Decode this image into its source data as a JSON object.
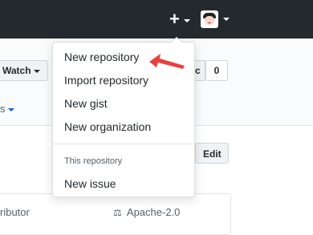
{
  "header": {
    "plus_icon": "+",
    "colors": {
      "background": "#24292e",
      "foreground": "#ffffff"
    }
  },
  "repo_actions": {
    "watch_label": "Watch",
    "star_count": "0",
    "partial_button_text": "c"
  },
  "tabs": {
    "partial_tab_text": "s"
  },
  "edit_button": {
    "label": "Edit"
  },
  "summary": {
    "contributors_text": "ributor",
    "license_icon": "⚖",
    "license_text": "Apache-2.0"
  },
  "dropdown": {
    "items": [
      {
        "label": "New repository"
      },
      {
        "label": "Import repository"
      },
      {
        "label": "New gist"
      },
      {
        "label": "New organization"
      }
    ],
    "section_header": "This repository",
    "section_items": [
      {
        "label": "New issue"
      }
    ]
  },
  "annotation": {
    "arrow_color": "#e8413c"
  }
}
